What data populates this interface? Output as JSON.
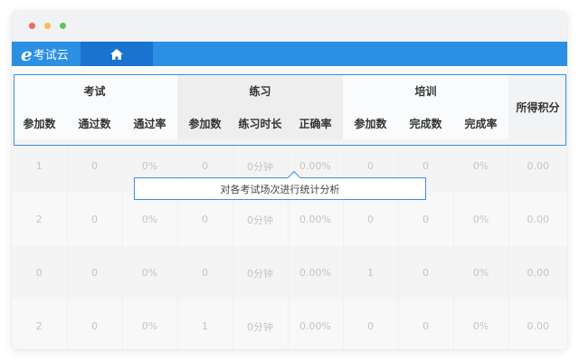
{
  "app": {
    "logo_letter": "e",
    "logo_text": "考试云",
    "nav_home_icon": "home-icon",
    "brand_color": "#2b8fe3"
  },
  "table": {
    "groups": {
      "exam": "考试",
      "practice": "练习",
      "training": "培训",
      "score": "所得积分"
    },
    "columns": [
      "参加数",
      "通过数",
      "通过率",
      "参加数",
      "练习时长",
      "正确率",
      "参加数",
      "完成数",
      "完成率"
    ],
    "rows": [
      [
        "1",
        "0",
        "0%",
        "0",
        "0分钟",
        "0.00%",
        "0",
        "0",
        "0%",
        "0.00"
      ],
      [
        "2",
        "0",
        "0%",
        "0",
        "0分钟",
        "0.00%",
        "0",
        "0",
        "0%",
        "0.00"
      ],
      [
        "0",
        "0",
        "0%",
        "0",
        "0分钟",
        "0.00%",
        "1",
        "0",
        "0%",
        "0.00"
      ],
      [
        "2",
        "0",
        "0%",
        "1",
        "0分钟",
        "0.00%",
        "0",
        "0",
        "0%",
        "0.00"
      ]
    ]
  },
  "tooltip": {
    "text": "对各考试场次进行统计分析"
  }
}
